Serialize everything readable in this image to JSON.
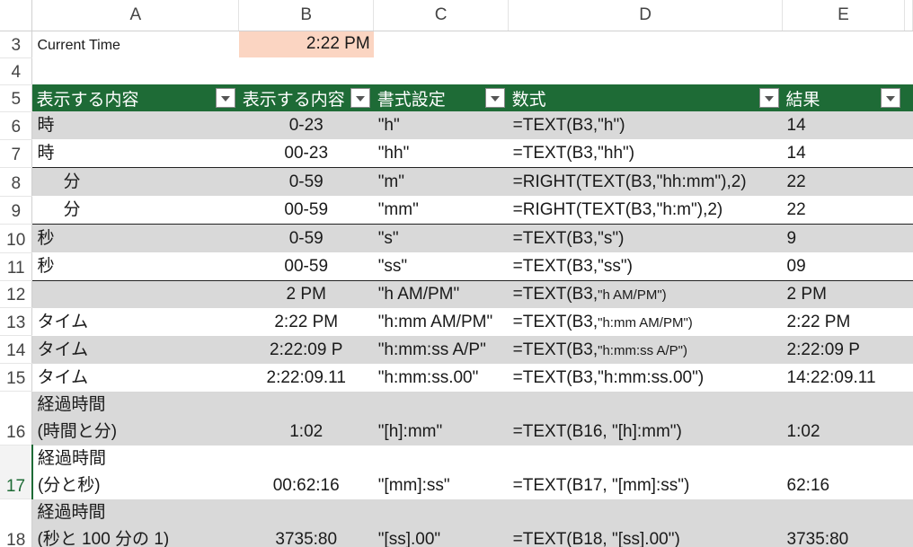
{
  "columns": [
    "A",
    "B",
    "C",
    "D",
    "E"
  ],
  "current_time": {
    "row": "3",
    "label": "Current Time",
    "value": "2:22 PM"
  },
  "blank_row": "4",
  "header": {
    "row": "5",
    "cells": [
      "表示する内容",
      "表示する内容",
      "書式設定",
      "数式",
      "結果"
    ]
  },
  "rows": [
    {
      "num": "6",
      "a": "時",
      "b": "0-23",
      "c": "\"h\"",
      "d_pre": "=TEXT(B3,",
      "d_arg": "\"h\")",
      "e": "14"
    },
    {
      "num": "7",
      "a": "時",
      "b": "00-23",
      "c": "\"hh\"",
      "d_pre": "=TEXT(B3,",
      "d_arg": "\"hh\")",
      "e": "14"
    },
    {
      "num": "8",
      "a": "分",
      "b": "0-59",
      "c": "\"m\"",
      "d_pre": "=RIGHT(TEXT(B3,",
      "d_arg": "\"hh:mm\"),2)",
      "e": "22"
    },
    {
      "num": "9",
      "a": "分",
      "b": "00-59",
      "c": "\"mm\"",
      "d_pre": "=RIGHT(TEXT(B3,",
      "d_arg": "\"h:m\"),2)",
      "e": "22"
    },
    {
      "num": "10",
      "a": "秒",
      "b": "0-59",
      "c": "\"s\"",
      "d_pre": "=TEXT(B3,",
      "d_arg": "\"s\")",
      "e": "9"
    },
    {
      "num": "11",
      "a": "秒",
      "b": "00-59",
      "c": "\"ss\"",
      "d_pre": "=TEXT(B3,",
      "d_arg": "\"ss\")",
      "e": "09"
    },
    {
      "num": "12",
      "a": "",
      "b": "2 PM",
      "c": "\"h AM/PM\"",
      "d_pre": "=TEXT(B3,",
      "d_arg": "\"h AM/PM\")",
      "e": "2 PM"
    },
    {
      "num": "13",
      "a": "タイム",
      "b": "2:22 PM",
      "c": "\"h:mm AM/PM\"",
      "d_pre": "=TEXT(B3,",
      "d_arg": "\"h:mm AM/PM\")",
      "e": "2:22 PM"
    },
    {
      "num": "14",
      "a": "タイム",
      "b": "2:22:09 P",
      "c": "\"h:mm:ss A/P\"",
      "d_pre": "=TEXT(B3,",
      "d_arg": "\"h:mm:ss A/P\")",
      "e": "2:22:09 P"
    },
    {
      "num": "15",
      "a": "タイム",
      "b": "2:22:09.11",
      "c": "\"h:mm:ss.00\"",
      "d_pre": "=TEXT(B3,",
      "d_arg": "\"h:mm:ss.00\")",
      "e": "14:22:09.11"
    }
  ],
  "elapsed": [
    {
      "num": "16",
      "a1": "経過時間",
      "a2": "(時間と分)",
      "b": "1:02",
      "c": "\"[h]:mm\"",
      "d": "=TEXT(B16, \"[h]:mm\")",
      "e": "1:02"
    },
    {
      "num": "17",
      "a1": "経過時間",
      "a2": "(分と秒)",
      "b": "00:62:16",
      "c": "\"[mm]:ss\"",
      "d": "=TEXT(B17, \"[mm]:ss\")",
      "e": "62:16"
    },
    {
      "num": "18",
      "a1": "経過時間",
      "a2": "(秒と 100 分の 1)",
      "b": "3735:80",
      "c": "\"[ss].00\"",
      "d": "=TEXT(B18, \"[ss].00\")",
      "e": "3735:80"
    }
  ],
  "colors": {
    "header_bg": "#1e6b36",
    "band": "#d9d9d9",
    "input_cell": "#fbd5c2"
  }
}
